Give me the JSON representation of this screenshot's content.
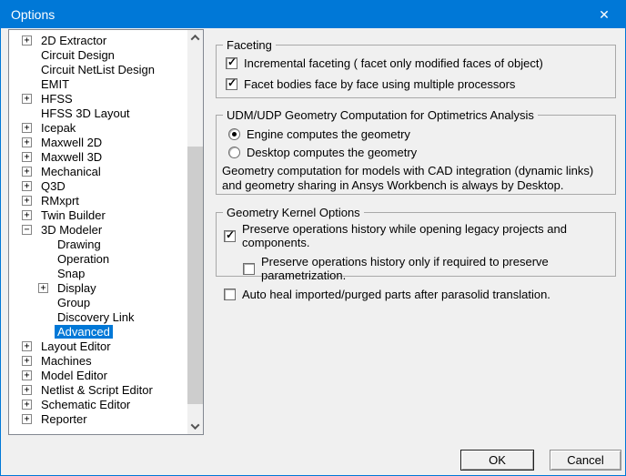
{
  "window": {
    "title": "Options",
    "close_glyph": "✕"
  },
  "colors": {
    "titlebar": "#0078d7",
    "accent": "#0078d7",
    "dialogbg": "#f0f0f0"
  },
  "tree": {
    "items": [
      {
        "label": "2D Extractor",
        "box": "+",
        "child": false,
        "selected": false
      },
      {
        "label": "Circuit Design",
        "box": "",
        "child": false,
        "selected": false
      },
      {
        "label": "Circuit NetList Design",
        "box": "",
        "child": false,
        "selected": false
      },
      {
        "label": "EMIT",
        "box": "",
        "child": false,
        "selected": false
      },
      {
        "label": "HFSS",
        "box": "+",
        "child": false,
        "selected": false
      },
      {
        "label": "HFSS 3D Layout",
        "box": "",
        "child": false,
        "selected": false
      },
      {
        "label": "Icepak",
        "box": "+",
        "child": false,
        "selected": false
      },
      {
        "label": "Maxwell 2D",
        "box": "+",
        "child": false,
        "selected": false
      },
      {
        "label": "Maxwell 3D",
        "box": "+",
        "child": false,
        "selected": false
      },
      {
        "label": "Mechanical",
        "box": "+",
        "child": false,
        "selected": false
      },
      {
        "label": "Q3D",
        "box": "+",
        "child": false,
        "selected": false
      },
      {
        "label": "RMxprt",
        "box": "+",
        "child": false,
        "selected": false
      },
      {
        "label": "Twin Builder",
        "box": "+",
        "child": false,
        "selected": false
      },
      {
        "label": "3D Modeler",
        "box": "−",
        "child": false,
        "selected": false
      },
      {
        "label": "Drawing",
        "box": "",
        "child": true,
        "selected": false
      },
      {
        "label": "Operation",
        "box": "",
        "child": true,
        "selected": false
      },
      {
        "label": "Snap",
        "box": "",
        "child": true,
        "selected": false
      },
      {
        "label": "Display",
        "box": "+",
        "child": true,
        "selected": false
      },
      {
        "label": "Group",
        "box": "",
        "child": true,
        "selected": false
      },
      {
        "label": "Discovery Link",
        "box": "",
        "child": true,
        "selected": false
      },
      {
        "label": "Advanced",
        "box": "",
        "child": true,
        "selected": true
      },
      {
        "label": "Layout Editor",
        "box": "+",
        "child": false,
        "selected": false
      },
      {
        "label": "Machines",
        "box": "+",
        "child": false,
        "selected": false
      },
      {
        "label": "Model Editor",
        "box": "+",
        "child": false,
        "selected": false
      },
      {
        "label": "Netlist & Script Editor",
        "box": "+",
        "child": false,
        "selected": false
      },
      {
        "label": "Schematic Editor",
        "box": "+",
        "child": false,
        "selected": false
      },
      {
        "label": "Reporter",
        "box": "+",
        "child": false,
        "selected": false
      }
    ]
  },
  "panels": {
    "faceting": {
      "title": "Faceting",
      "checkboxes": [
        {
          "label": "Incremental faceting  ( facet only modified faces of object)",
          "checked": true,
          "indent": false
        },
        {
          "label": "Facet bodies face by face using multiple processors",
          "checked": true,
          "indent": false
        }
      ]
    },
    "udm": {
      "title": "UDM/UDP Geometry Computation for Optimetrics Analysis",
      "radios": [
        {
          "label": "Engine computes the geometry",
          "selected": true
        },
        {
          "label": "Desktop computes the geometry",
          "selected": false
        }
      ],
      "note": "Geometry computation for models with CAD integration (dynamic links) and geometry sharing in Ansys Workbench is always by Desktop."
    },
    "kernel": {
      "title": "Geometry Kernel Options",
      "checkboxes": [
        {
          "label": "Preserve operations history while opening legacy projects and components.",
          "checked": true,
          "indent": false
        },
        {
          "label": "Preserve operations history only if required to preserve parametrization.",
          "checked": false,
          "indent": true
        },
        {
          "label": "Auto heal imported/purged parts after parasolid translation.",
          "checked": false,
          "indent": false
        }
      ]
    }
  },
  "buttons": {
    "ok": "OK",
    "cancel": "Cancel"
  }
}
